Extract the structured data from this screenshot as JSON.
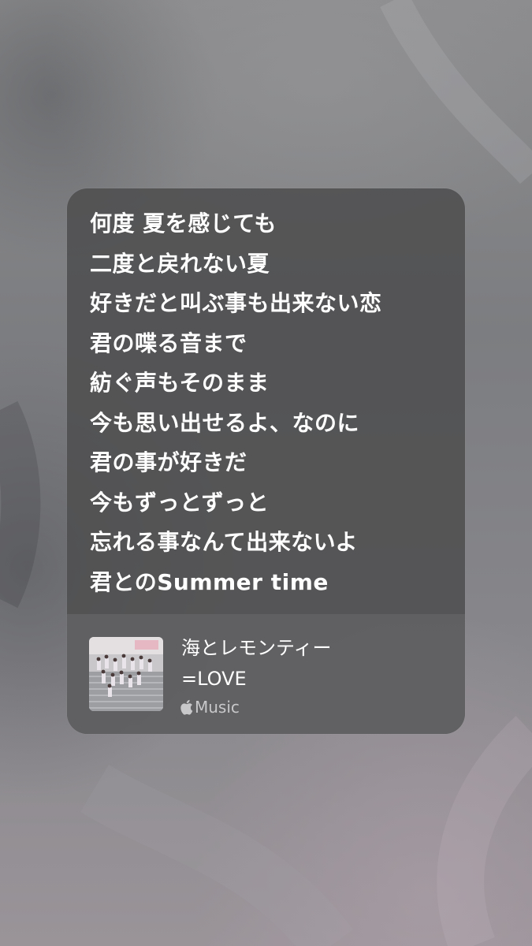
{
  "lyrics_card": {
    "lines": [
      "何度 夏を感じても",
      "二度と戻れない夏",
      "好きだと叫ぶ事も出来ない恋",
      "君の喋る音まで",
      "紡ぐ声もそのまま",
      "今も思い出せるよ、なのに",
      "君の事が好きだ",
      "今もずっとずっと",
      "忘れる事なんて出来ないよ",
      "君とのSummer time"
    ],
    "song_title": "海とレモンティー",
    "artist": "=LOVE",
    "service_label": "Music",
    "service_icon": "apple-logo-icon",
    "artwork_icon": "album-artwork"
  },
  "colors": {
    "card": "#4e4e50",
    "footer": "#626264",
    "text": "#ffffff",
    "service_text": "#c8c8ca"
  }
}
